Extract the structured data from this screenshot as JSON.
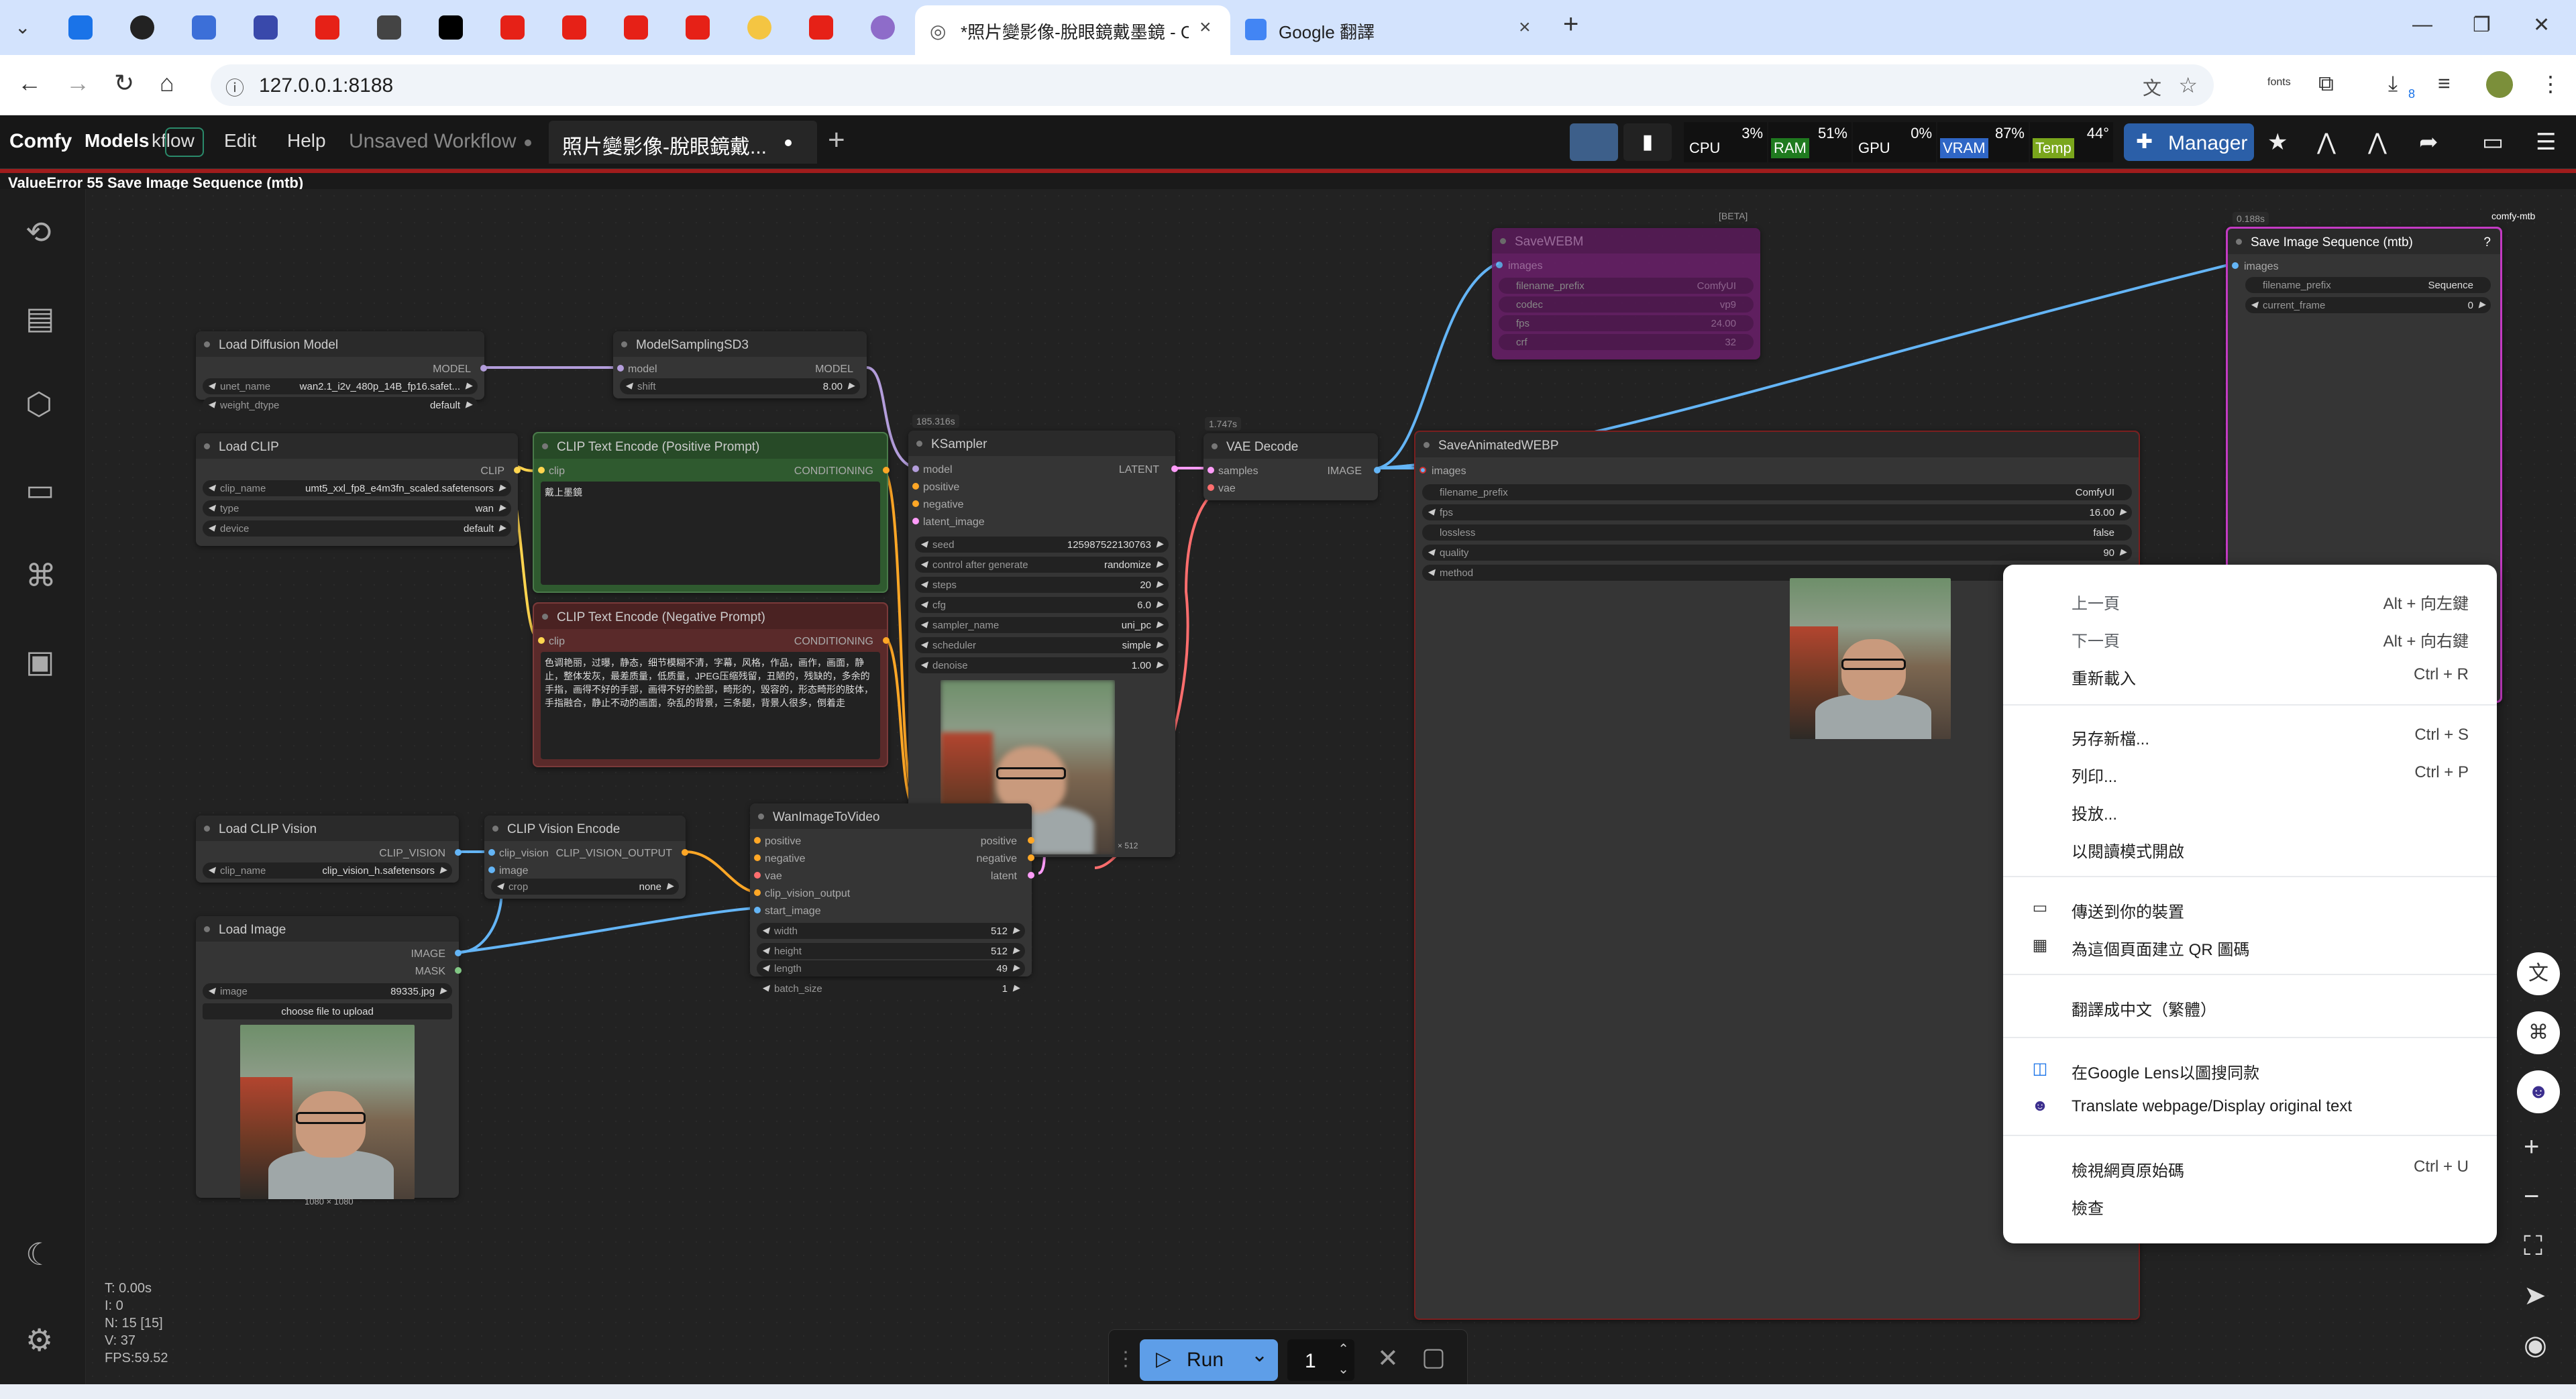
{
  "browser": {
    "tabs": [
      {
        "title": "*照片變影像-脫眼鏡戴墨鏡 - Cc"
      },
      {
        "title": "Google 翻譯"
      }
    ],
    "url": "127.0.0.1:8188",
    "ext_label": "fonts",
    "download_count": "8"
  },
  "comfy": {
    "logo": "Comfy",
    "menu": [
      "Models",
      "kflow",
      "Edit",
      "Help"
    ],
    "workflow_tabs": [
      {
        "label": "Unsaved Workflow"
      },
      {
        "label": "照片變影像-脫眼鏡戴..."
      }
    ],
    "monitor": {
      "cpu": {
        "label": "CPU",
        "value": "3%"
      },
      "ram": {
        "label": "RAM",
        "value": "51%"
      },
      "gpu": {
        "label": "GPU",
        "value": "0%"
      },
      "vram": {
        "label": "VRAM",
        "value": "87%"
      },
      "temp": {
        "label": "Temp",
        "value": "44°"
      }
    },
    "manager_label": "Manager",
    "error_text": "ValueError 55 Save Image Sequence (mtb)"
  },
  "nodes": {
    "load_diffusion": {
      "title": "Load Diffusion Model",
      "out": "MODEL",
      "widgets": [
        {
          "k": "unet_name",
          "v": "wan2.1_i2v_480p_14B_fp16.safet..."
        },
        {
          "k": "weight_dtype",
          "v": "default"
        }
      ]
    },
    "model_sampling": {
      "title": "ModelSamplingSD3",
      "in": "model",
      "out": "MODEL",
      "widgets": [
        {
          "k": "shift",
          "v": "8.00"
        }
      ]
    },
    "load_clip": {
      "title": "Load CLIP",
      "out": "CLIP",
      "widgets": [
        {
          "k": "clip_name",
          "v": "umt5_xxl_fp8_e4m3fn_scaled.safetensors"
        },
        {
          "k": "type",
          "v": "wan"
        },
        {
          "k": "device",
          "v": "default"
        }
      ]
    },
    "clip_pos": {
      "title": "CLIP Text Encode (Positive Prompt)",
      "in": "clip",
      "out": "CONDITIONING",
      "text": "戴上墨鏡"
    },
    "clip_neg": {
      "title": "CLIP Text Encode (Negative Prompt)",
      "in": "clip",
      "out": "CONDITIONING",
      "text": "色调艳丽，过曝，静态，细节模糊不清，字幕，风格，作品，画作，画面，静止，整体发灰，最差质量，低质量，JPEG压缩残留，丑陋的，残缺的，多余的手指，画得不好的手部，画得不好的脸部，畸形的，毁容的，形态畸形的肢体，手指融合，静止不动的画面，杂乱的背景，三条腿，背景人很多，倒着走"
    },
    "ksampler": {
      "title": "KSampler",
      "badge": "185.316s",
      "inputs": [
        "model",
        "positive",
        "negative",
        "latent_image"
      ],
      "out": "LATENT",
      "widgets": [
        {
          "k": "seed",
          "v": "125987522130763"
        },
        {
          "k": "control after generate",
          "v": "randomize"
        },
        {
          "k": "steps",
          "v": "20"
        },
        {
          "k": "cfg",
          "v": "6.0"
        },
        {
          "k": "sampler_name",
          "v": "uni_pc"
        },
        {
          "k": "scheduler",
          "v": "simple"
        },
        {
          "k": "denoise",
          "v": "1.00"
        }
      ],
      "preview_caption": "× 512"
    },
    "vae_decode": {
      "title": "VAE Decode",
      "badge": "1.747s",
      "inputs": [
        "samples",
        "vae"
      ],
      "out": "IMAGE"
    },
    "save_webp_anim": {
      "title": "SaveAnimatedWEBP",
      "in": "images",
      "widgets": [
        {
          "k": "filename_prefix",
          "v": "ComfyUI"
        },
        {
          "k": "fps",
          "v": "16.00"
        },
        {
          "k": "lossless",
          "v": "false"
        },
        {
          "k": "quality",
          "v": "90"
        },
        {
          "k": "method",
          "v": ""
        }
      ]
    },
    "save_webm": {
      "title": "SaveWEBM",
      "badge": "[BETA]",
      "in": "images",
      "widgets": [
        {
          "k": "filename_prefix",
          "v": "ComfyUI"
        },
        {
          "k": "codec",
          "v": "vp9"
        },
        {
          "k": "fps",
          "v": "24.00"
        },
        {
          "k": "crf",
          "v": "32"
        }
      ]
    },
    "save_seq": {
      "title": "Save Image Sequence (mtb)",
      "badge": "0.188s",
      "tag": "comfy-mtb",
      "help": "?",
      "in": "images",
      "widgets": [
        {
          "k": "filename_prefix",
          "v": "Sequence"
        },
        {
          "k": "current_frame",
          "v": "0"
        }
      ]
    },
    "load_clip_vision": {
      "title": "Load CLIP Vision",
      "out": "CLIP_VISION",
      "widgets": [
        {
          "k": "clip_name",
          "v": "clip_vision_h.safetensors"
        }
      ]
    },
    "clip_vision_encode": {
      "title": "CLIP Vision Encode",
      "inputs": [
        "clip_vision",
        "image"
      ],
      "out": "CLIP_VISION_OUTPUT",
      "widgets": [
        {
          "k": "crop",
          "v": "none"
        }
      ]
    },
    "wan_i2v": {
      "title": "WanImageToVideo",
      "inputs": [
        "positive",
        "negative",
        "vae",
        "clip_vision_output",
        "start_image"
      ],
      "outputs": [
        "positive",
        "negative",
        "latent"
      ],
      "widgets": [
        {
          "k": "width",
          "v": "512"
        },
        {
          "k": "height",
          "v": "512"
        },
        {
          "k": "length",
          "v": "49"
        },
        {
          "k": "batch_size",
          "v": "1"
        }
      ]
    },
    "load_image": {
      "title": "Load Image",
      "outputs": [
        "IMAGE",
        "MASK"
      ],
      "widgets": [
        {
          "k": "image",
          "v": "89335.jpg"
        }
      ],
      "upload_label": "choose file to upload",
      "caption": "1080 × 1080"
    }
  },
  "context_menu": {
    "items": [
      {
        "label": "上一頁",
        "shortcut": "Alt + 向左鍵"
      },
      {
        "label": "下一頁",
        "shortcut": "Alt + 向右鍵"
      },
      {
        "label": "重新載入",
        "shortcut": "Ctrl + R"
      },
      {
        "label": "另存新檔...",
        "shortcut": "Ctrl + S"
      },
      {
        "label": "列印...",
        "shortcut": "Ctrl + P"
      },
      {
        "label": "投放...",
        "shortcut": ""
      },
      {
        "label": "以閱讀模式開啟",
        "shortcut": ""
      },
      {
        "label": "傳送到你的裝置",
        "shortcut": ""
      },
      {
        "label": "為這個頁面建立 QR 圖碼",
        "shortcut": ""
      },
      {
        "label": "翻譯成中文（繁體）",
        "shortcut": ""
      },
      {
        "label": "在Google Lens以圖搜同款",
        "shortcut": ""
      },
      {
        "label": "Translate webpage/Display original text",
        "shortcut": ""
      },
      {
        "label": "檢視網頁原始碼",
        "shortcut": "Ctrl + U"
      },
      {
        "label": "檢查",
        "shortcut": ""
      }
    ]
  },
  "runbar": {
    "run_label": "Run",
    "batch_count": "1"
  },
  "stats": [
    "T: 0.00s",
    "I: 0",
    "N: 15 [15]",
    "V: 37",
    "FPS:59.52"
  ],
  "colors": {
    "accent_blue": "#2b5fa8",
    "run_blue": "#5e9ee8",
    "error_red": "#a01c1c",
    "link_model": "#b39ddb",
    "link_clip": "#ffd54f",
    "link_cond": "#ffa726",
    "link_latent": "#ff9cf9",
    "link_image": "#64b5f6",
    "link_vae": "#ff6e6e",
    "node_positive": "#2f5a2f",
    "node_negative": "#5a2a2a",
    "node_bypassed": "#6a1f6a"
  }
}
